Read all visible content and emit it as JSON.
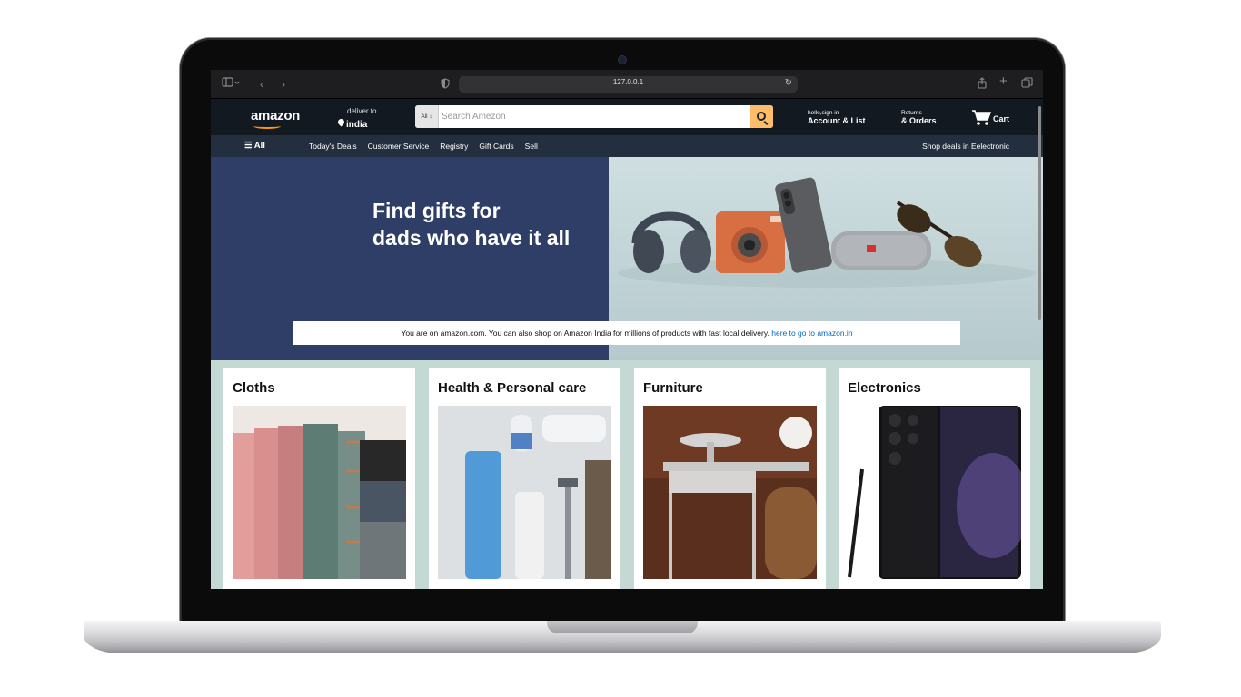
{
  "browser": {
    "url": "127.0.0.1"
  },
  "header": {
    "logo": "amazon",
    "deliver_label": "deliver to",
    "deliver_location": "india",
    "search_category": "All",
    "search_placeholder": "Search Amezon",
    "account_line1": "hello,sign in",
    "account_line2": "Account & List",
    "returns_line1": "Returns",
    "returns_line2": "& Orders",
    "cart_label": "Cart"
  },
  "subnav": {
    "all_label": "☰ All",
    "links": [
      "Today's Deals",
      "Customer Service",
      "Registry",
      "Gift Cards",
      "Sell"
    ],
    "deal_text": "Shop deals in Eelectronic"
  },
  "hero": {
    "title_line1": "Find gifts for",
    "title_line2": "dads who have it all"
  },
  "notice": {
    "text": "You are on amazon.com. You can also shop on Amazon India for millions of products with fast local delivery.",
    "link": "here to go to amazon.in"
  },
  "cards": [
    {
      "title": "Cloths"
    },
    {
      "title": "Health & Personal care"
    },
    {
      "title": "Furniture"
    },
    {
      "title": "Electronics"
    }
  ],
  "colors": {
    "header_bg": "#131921",
    "subnav_bg": "#232f3e",
    "search_button": "#febd69",
    "hero_left": "#2f3e66",
    "cards_bg": "#c4d8d4",
    "link": "#0066c0"
  }
}
